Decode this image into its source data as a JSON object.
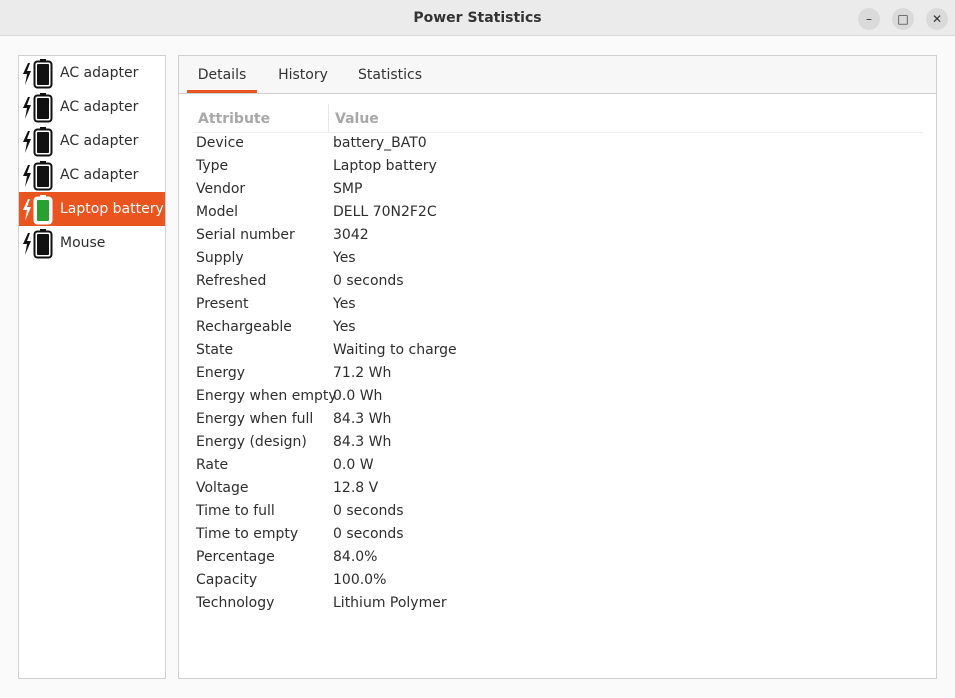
{
  "window": {
    "title": "Power Statistics",
    "minimize_label": "–",
    "maximize_label": "□",
    "close_label": "✕"
  },
  "devices": [
    {
      "label": "AC adapter",
      "icon": "battery-ac-icon",
      "selected": false
    },
    {
      "label": "AC adapter",
      "icon": "battery-ac-icon",
      "selected": false
    },
    {
      "label": "AC adapter",
      "icon": "battery-ac-icon",
      "selected": false
    },
    {
      "label": "AC adapter",
      "icon": "battery-ac-icon",
      "selected": false
    },
    {
      "label": "Laptop battery",
      "icon": "battery-charging-icon",
      "selected": true
    },
    {
      "label": "Mouse",
      "icon": "battery-mouse-icon",
      "selected": false
    }
  ],
  "tabs": [
    {
      "label": "Details",
      "active": true
    },
    {
      "label": "History",
      "active": false
    },
    {
      "label": "Statistics",
      "active": false
    }
  ],
  "table": {
    "headers": {
      "attribute": "Attribute",
      "value": "Value"
    },
    "rows": [
      {
        "attribute": "Device",
        "value": "battery_BAT0"
      },
      {
        "attribute": "Type",
        "value": "Laptop battery"
      },
      {
        "attribute": "Vendor",
        "value": "SMP"
      },
      {
        "attribute": "Model",
        "value": "DELL 70N2F2C"
      },
      {
        "attribute": "Serial number",
        "value": "3042"
      },
      {
        "attribute": "Supply",
        "value": "Yes"
      },
      {
        "attribute": "Refreshed",
        "value": "0 seconds"
      },
      {
        "attribute": "Present",
        "value": "Yes"
      },
      {
        "attribute": "Rechargeable",
        "value": "Yes"
      },
      {
        "attribute": "State",
        "value": "Waiting to charge"
      },
      {
        "attribute": "Energy",
        "value": "71.2 Wh"
      },
      {
        "attribute": "Energy when empty",
        "value": "0.0 Wh"
      },
      {
        "attribute": "Energy when full",
        "value": "84.3 Wh"
      },
      {
        "attribute": "Energy (design)",
        "value": "84.3 Wh"
      },
      {
        "attribute": "Rate",
        "value": "0.0 W"
      },
      {
        "attribute": "Voltage",
        "value": "12.8 V"
      },
      {
        "attribute": "Time to full",
        "value": "0 seconds"
      },
      {
        "attribute": "Time to empty",
        "value": "0 seconds"
      },
      {
        "attribute": "Percentage",
        "value": "84.0%"
      },
      {
        "attribute": "Capacity",
        "value": "100.0%"
      },
      {
        "attribute": "Technology",
        "value": "Lithium Polymer"
      }
    ]
  },
  "colors": {
    "accent": "#e9541f",
    "battery_fill_charging": "#27a12f"
  }
}
